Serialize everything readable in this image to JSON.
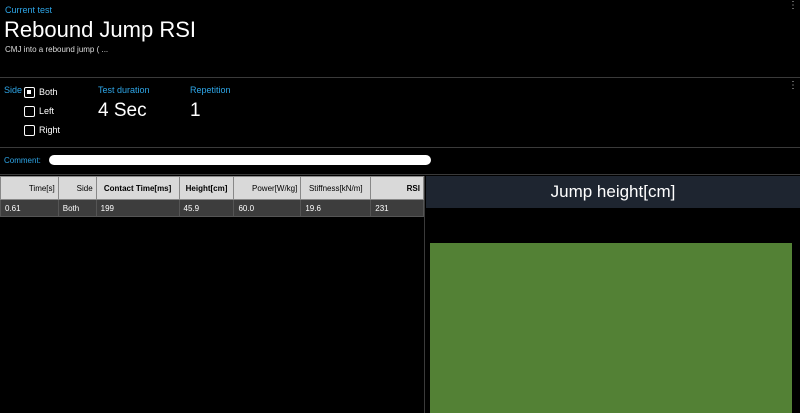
{
  "header": {
    "current_test_label": "Current test",
    "title": "Rebound Jump RSI",
    "description": "CMJ into a rebound jump ( ..."
  },
  "params": {
    "side_label": "Side",
    "side_options": [
      "Both",
      "Left",
      "Right"
    ],
    "selected_side": "Both",
    "duration_label": "Test duration",
    "duration_value": "4 Sec",
    "repetition_label": "Repetition",
    "repetition_value": "1"
  },
  "comment": {
    "label": "Comment:",
    "value": ""
  },
  "table": {
    "columns": [
      "Time[s]",
      "Side",
      "Contact Time[ms]",
      "Height[cm]",
      "Power[W/kg]",
      "Stiffness[kN/m]",
      "RSI"
    ],
    "rows": [
      [
        "0.61",
        "Both",
        "199",
        "45.9",
        "60.0",
        "19.6",
        "231"
      ]
    ]
  },
  "colors": {
    "accent": "#2ea6e8",
    "bar": "#538135",
    "title_bar": "#1e2530"
  },
  "chart_data": {
    "type": "bar",
    "title": "Jump height[cm]",
    "categories": [
      ""
    ],
    "values": [
      45.9
    ],
    "xlabel": "",
    "ylabel": "",
    "grid": false
  }
}
